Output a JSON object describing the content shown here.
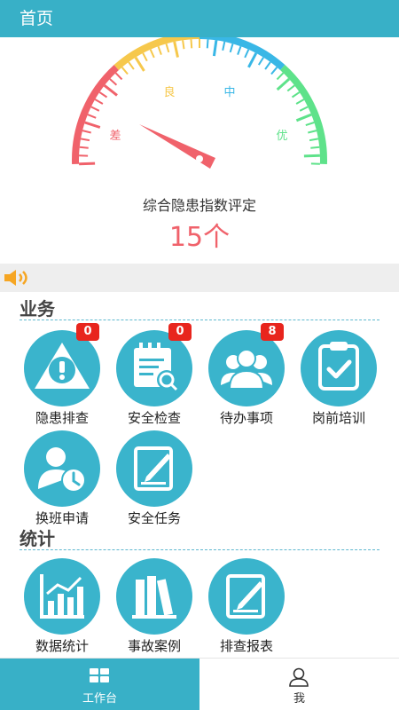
{
  "header": {
    "title": "首页"
  },
  "gauge": {
    "title": "综合隐患指数评定",
    "value": "15个",
    "levels": [
      {
        "label": "差",
        "color": "#f0626b"
      },
      {
        "label": "良",
        "color": "#f6c84c"
      },
      {
        "label": "中",
        "color": "#39b7e6"
      },
      {
        "label": "优",
        "color": "#5ee28a"
      }
    ],
    "needle_color": "#f0626b"
  },
  "notice": {
    "icon": "speaker-icon",
    "color": "#f6a623"
  },
  "sections": {
    "business": {
      "title": "业务",
      "items": [
        {
          "label": "隐患排查",
          "icon": "hazard-warning-icon",
          "badge": "0"
        },
        {
          "label": "安全检查",
          "icon": "calendar-search-icon",
          "badge": "0"
        },
        {
          "label": "待办事项",
          "icon": "group-icon",
          "badge": "8"
        },
        {
          "label": "岗前培训",
          "icon": "clipboard-check-icon"
        },
        {
          "label": "换班申请",
          "icon": "person-clock-icon"
        },
        {
          "label": "安全任务",
          "icon": "edit-note-icon"
        }
      ]
    },
    "stats": {
      "title": "统计",
      "items": [
        {
          "label": "数据统计",
          "icon": "bar-chart-icon"
        },
        {
          "label": "事故案例",
          "icon": "books-icon"
        },
        {
          "label": "排查报表",
          "icon": "report-edit-icon"
        }
      ]
    }
  },
  "tabbar": {
    "tabs": [
      {
        "label": "工作台",
        "icon": "grid-icon",
        "active": true
      },
      {
        "label": "我",
        "icon": "user-icon",
        "active": false
      }
    ]
  },
  "colors": {
    "primary": "#38b0c7",
    "badge": "#e8251d"
  }
}
